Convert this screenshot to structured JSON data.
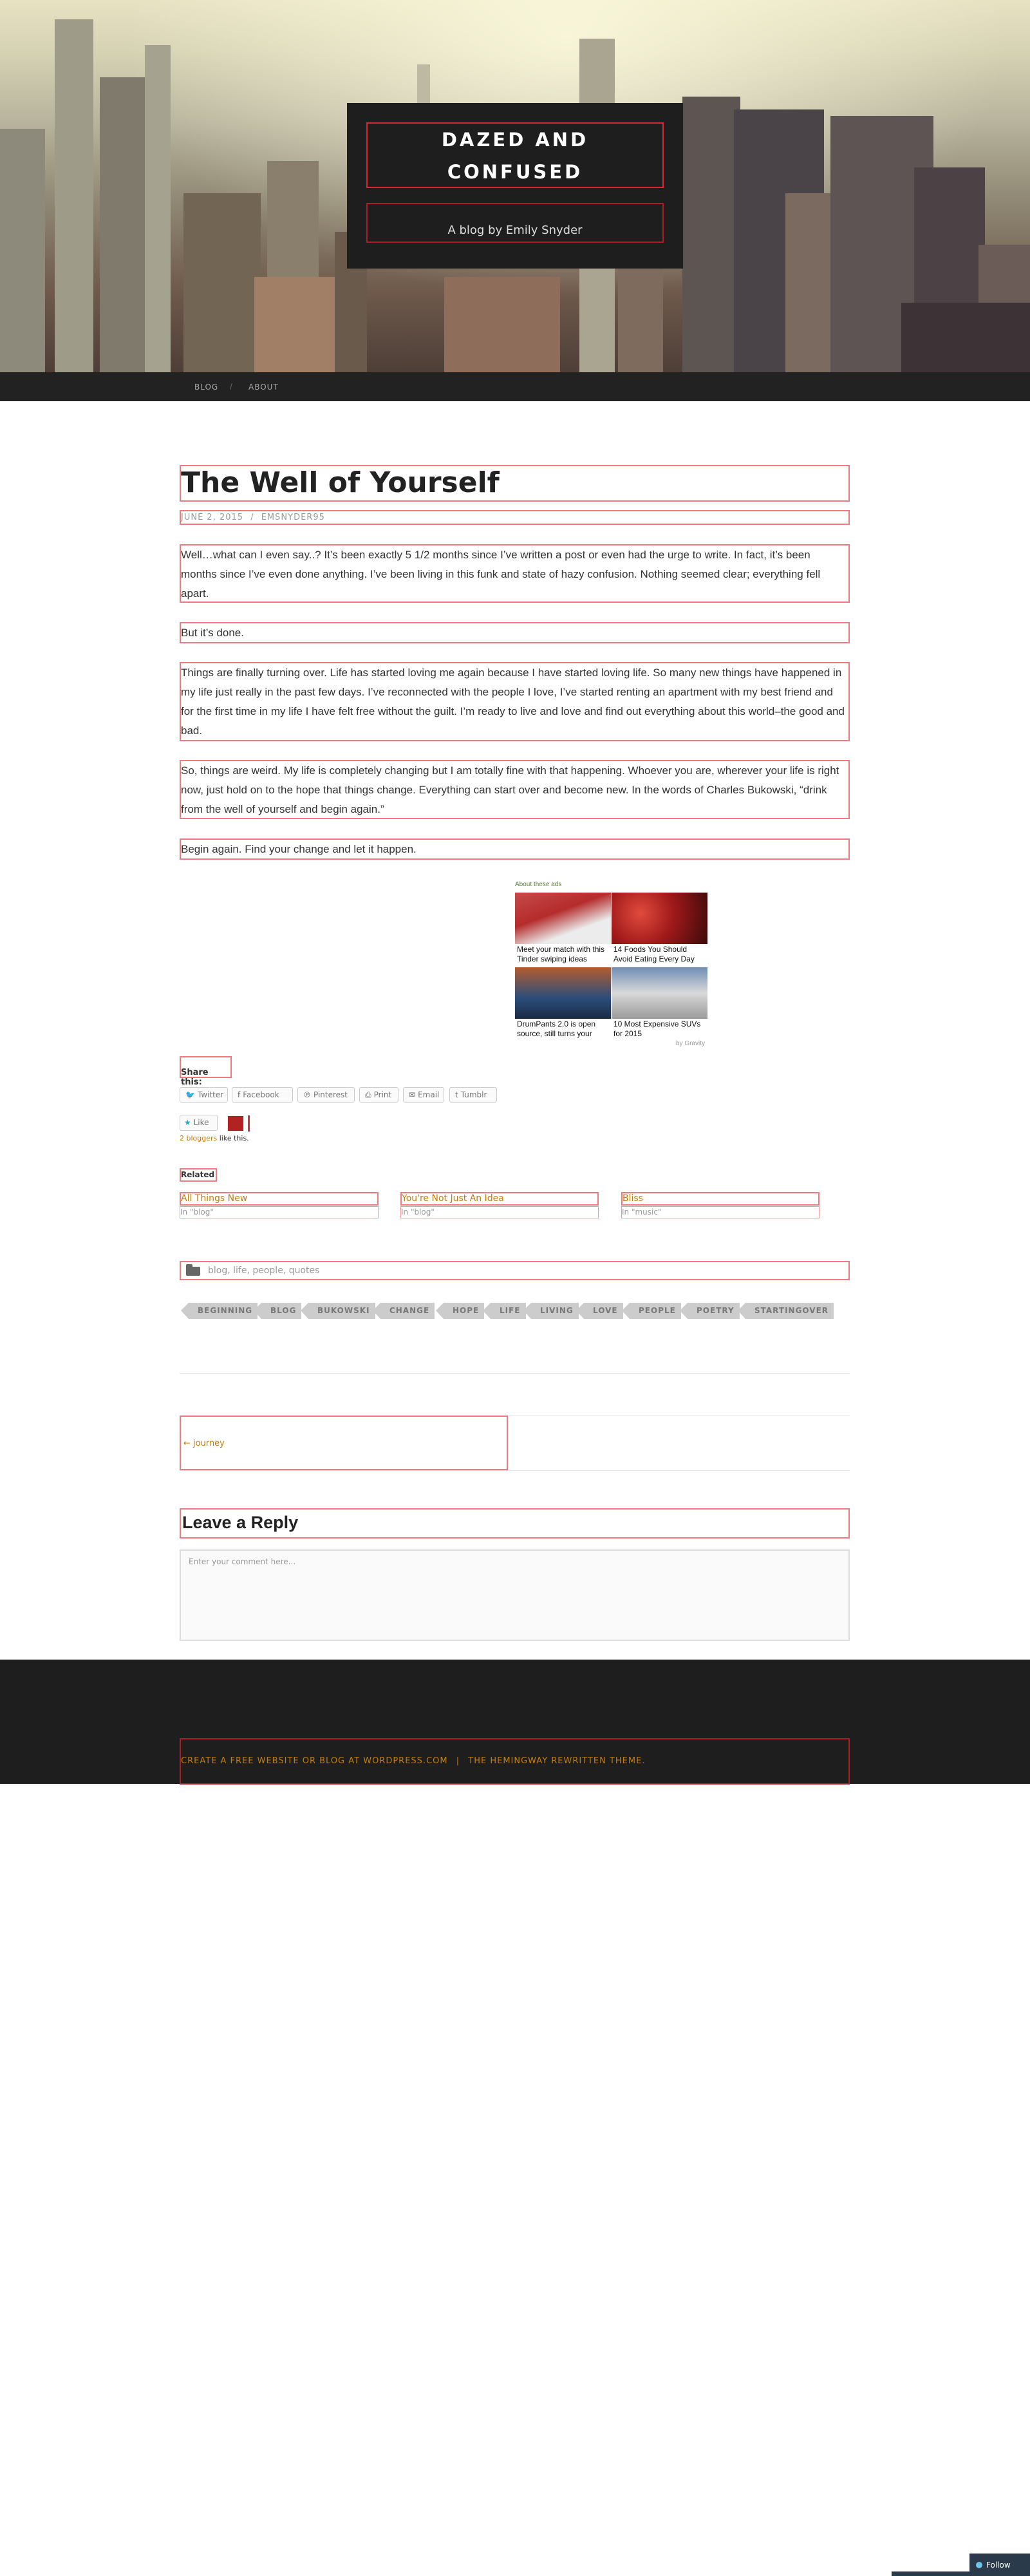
{
  "site": {
    "title_line1": "DAZED AND",
    "title_line2": "CONFUSED",
    "description": "A blog by Emily Snyder"
  },
  "nav": {
    "items": [
      {
        "label": "BLOG"
      },
      {
        "label": "ABOUT"
      }
    ],
    "separator": "/"
  },
  "post": {
    "title": "The Well of Yourself",
    "date": "JUNE 2, 2015",
    "meta_sep": "/",
    "author": "EMSNYDER95",
    "paragraphs": [
      "Well…what can I even say..? It’s been exactly 5 1/2 months since I’ve written a post or even had the urge to write. In fact, it’s been months since I’ve even done anything. I’ve been living in this funk and state of hazy confusion. Nothing seemed clear; everything fell apart.",
      "But it’s done.",
      "Things are finally turning over. Life has started loving me again because I have started loving life. So many new things have happened in my life just really in the past few days. I’ve reconnected with the people I love, I’ve started renting an apartment with my best friend and for the first time in my life I have felt free without the guilt. I’m ready to live and love and find out everything about this world–the good and bad.",
      "So, things are weird. My life is completely changing but I am totally fine with that happening. Whoever you are, wherever your life is right now, just hold on to the hope that things change. Everything can start over and become new. In the words of Charles Bukowski, “drink from the well of yourself and begin again.”",
      "Begin again. Find your change and let it happen."
    ]
  },
  "ads": {
    "label": "About these ads",
    "tiles": [
      {
        "caption": "Meet your match with this Tinder swiping ideas"
      },
      {
        "caption": "14 Foods You Should Avoid Eating Every Day"
      },
      {
        "caption": "DrumPants 2.0 is open source, still turns your"
      },
      {
        "caption": "10 Most Expensive SUVs for 2015"
      }
    ],
    "by": "by Gravity"
  },
  "share": {
    "title": "Share this:",
    "buttons": [
      {
        "label": "Twitter",
        "icon": "twitter-icon"
      },
      {
        "label": "Facebook",
        "icon": "facebook-icon"
      },
      {
        "label": "Pinterest",
        "icon": "pinterest-icon"
      },
      {
        "label": "Print",
        "icon": "print-icon"
      },
      {
        "label": "Email",
        "icon": "email-icon"
      },
      {
        "label": "Tumblr",
        "icon": "tumblr-icon"
      }
    ]
  },
  "likes": {
    "button": "Like",
    "count_link": "2 bloggers",
    "suffix": " like this."
  },
  "related": {
    "heading": "Related",
    "items": [
      {
        "title": "All Things New",
        "category": "In \"blog\""
      },
      {
        "title": "You're Not Just An Idea",
        "category": "In \"blog\""
      },
      {
        "title": "Bliss",
        "category": "In \"music\""
      }
    ]
  },
  "categories": {
    "text": "blog, life, people, quotes"
  },
  "tags": [
    "BEGINNING",
    "BLOG",
    "BUKOWSKI",
    "CHANGE",
    "HOPE",
    "LIFE",
    "LIVING",
    "LOVE",
    "PEOPLE",
    "POETRY",
    "STARTINGOVER"
  ],
  "post_nav": {
    "prev": "← journey"
  },
  "reply": {
    "title": "Leave a Reply",
    "placeholder": "Enter your comment here..."
  },
  "footer": {
    "credit1": "CREATE A FREE WEBSITE OR BLOG AT WORDPRESS.COM",
    "sep": "|",
    "credit2": "THE HEMINGWAY REWRITTEN THEME."
  },
  "follow": {
    "label": "Follow"
  },
  "colors": {
    "accent": "#c27c0e",
    "highlight_border": "#ee7a7f",
    "dark": "#1e1e1e"
  }
}
